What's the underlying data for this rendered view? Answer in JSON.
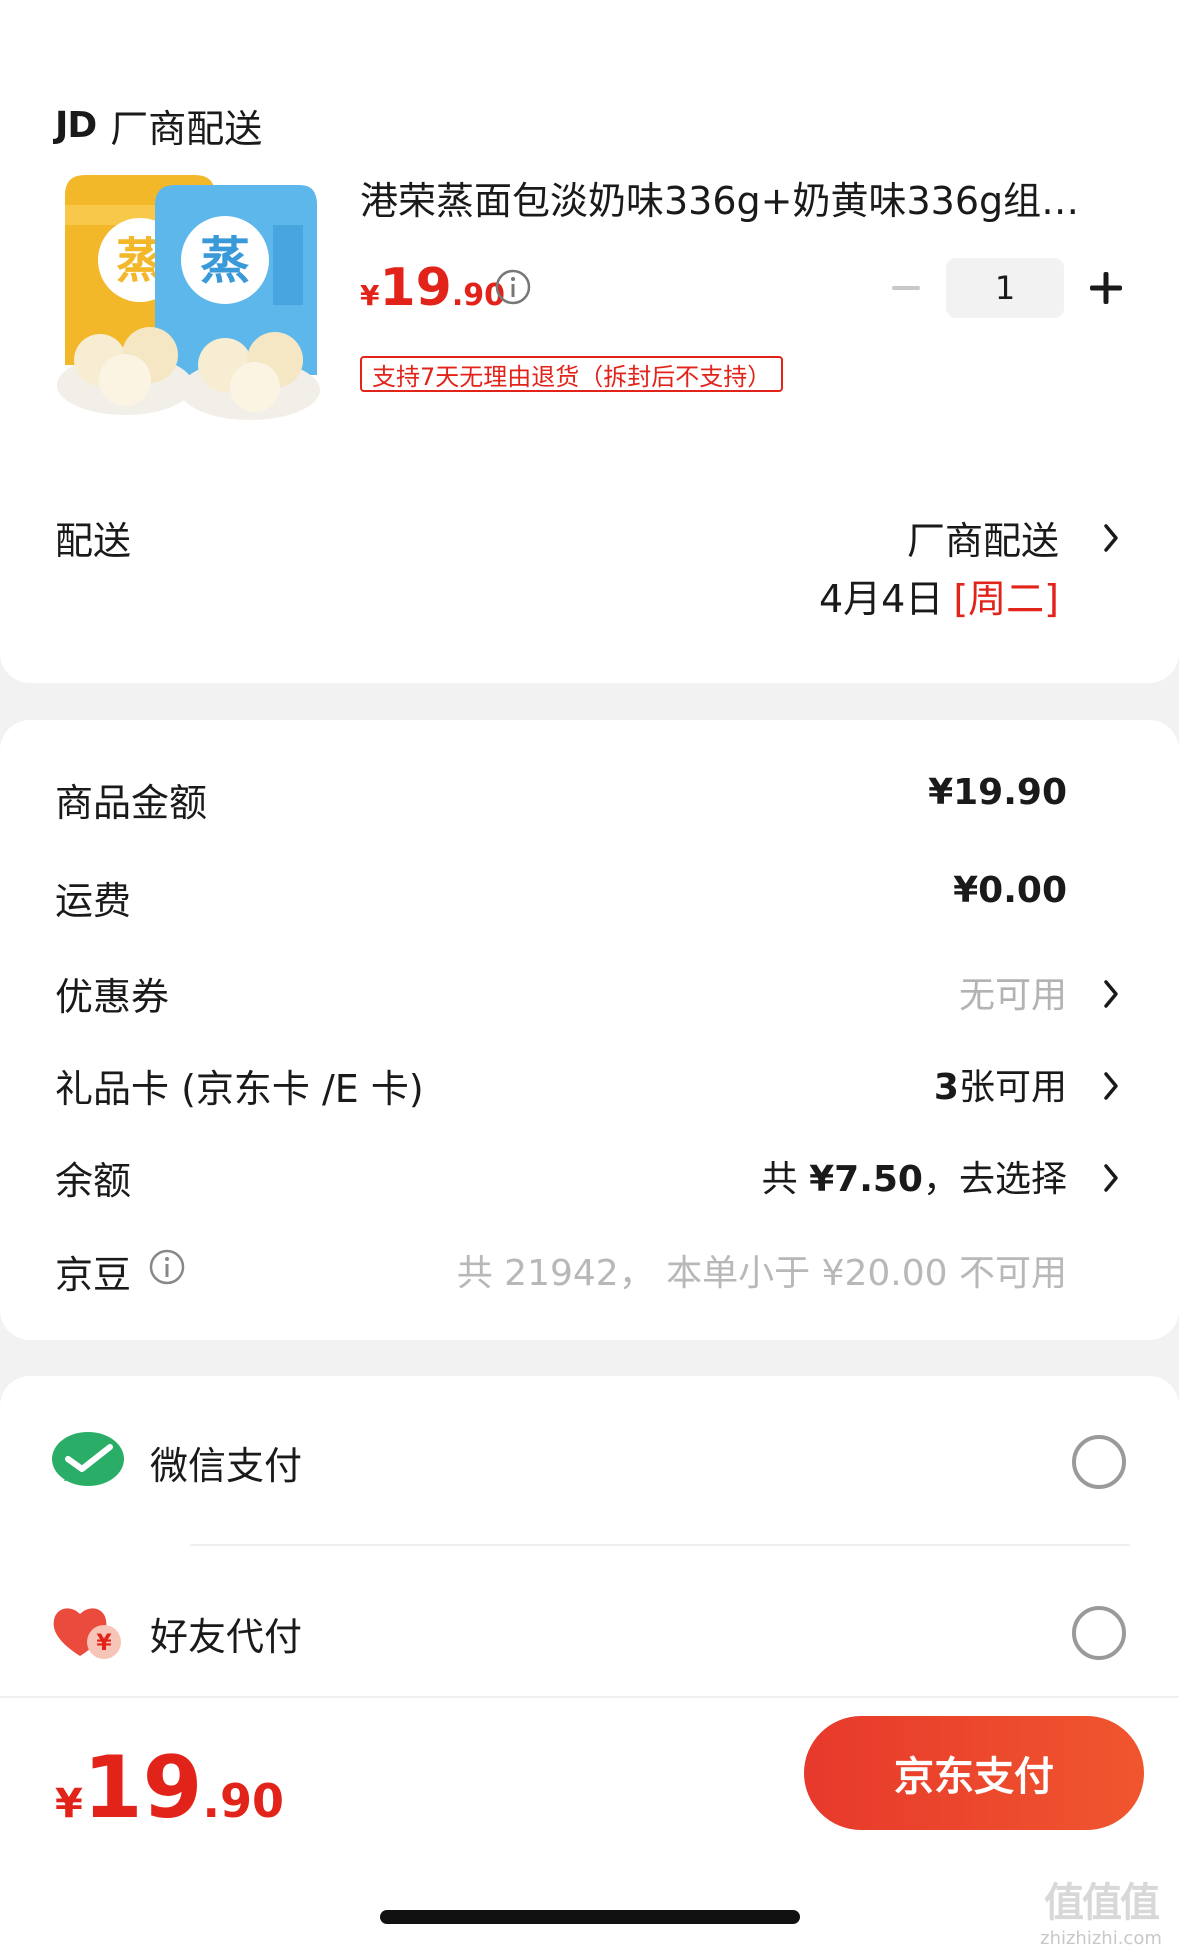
{
  "store": {
    "logo": "JD",
    "name": "厂商配送"
  },
  "product": {
    "title": "港荣蒸面包淡奶味336g+奶黄味336g组…",
    "image_text": "蒸",
    "price_symbol": "¥",
    "price_integer": "19",
    "price_decimal": ".90",
    "quantity": "1",
    "return_policy": "支持7天无理由退货（拆封后不支持）"
  },
  "delivery": {
    "label": "配送",
    "method": "厂商配送",
    "date": "4月4日",
    "weekday": "[周二]"
  },
  "summary": {
    "items": [
      {
        "label": "商品金额",
        "value": "¥19.90"
      },
      {
        "label": "运费",
        "value": "¥0.00"
      },
      {
        "label": "优惠券",
        "value": "无可用"
      },
      {
        "label": "礼品卡 (京东卡 /E 卡)",
        "value_bold": "3",
        "value_rest": "张可用"
      },
      {
        "label": "余额",
        "value_prefix": "共 ",
        "value_bold": "¥7.50",
        "value_rest": "，去选择"
      },
      {
        "label": "京豆",
        "value": "共 21942， 本单小于 ¥20.00 不可用"
      }
    ]
  },
  "payment": {
    "options": [
      {
        "label": "微信支付",
        "icon": "wechat-icon"
      },
      {
        "label": "好友代付",
        "icon": "friend-pay-icon"
      }
    ]
  },
  "footer": {
    "total_symbol": "¥",
    "total_integer": "19",
    "total_decimal": ".90",
    "pay_button": "京东支付"
  },
  "watermark": {
    "logo": "值值值",
    "text": "zhizhizhi.com"
  },
  "colors": {
    "accent_red": "#e2231a",
    "wechat_green": "#2aae67",
    "pay_button": "#ec4a2d"
  }
}
